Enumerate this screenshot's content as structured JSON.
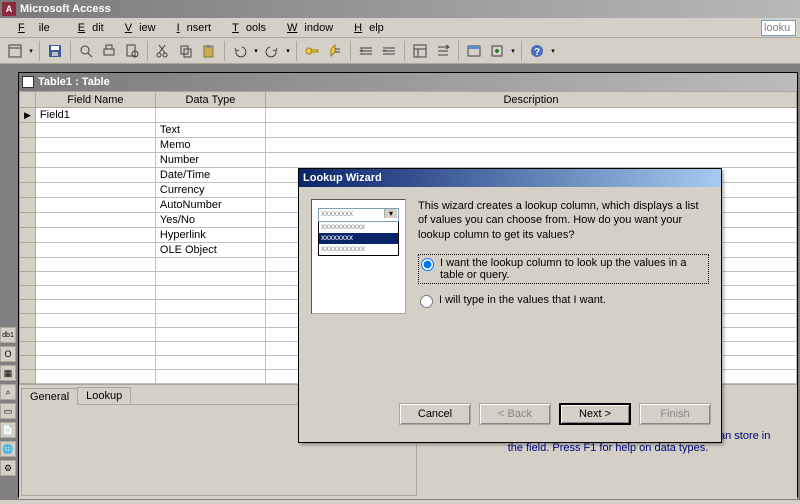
{
  "titlebar": {
    "app": "Microsoft Access"
  },
  "menu": {
    "file": "File",
    "edit": "Edit",
    "view": "View",
    "insert": "Insert",
    "tools": "Tools",
    "window": "Window",
    "help": "Help",
    "search_hint": "looku"
  },
  "tablewin": {
    "title": "Table1 : Table"
  },
  "grid": {
    "headers": {
      "field": "Field Name",
      "type": "Data Type",
      "desc": "Description"
    },
    "row1_field": "Field1",
    "types": [
      "Text",
      "Memo",
      "Number",
      "Date/Time",
      "Currency",
      "AutoNumber",
      "Yes/No",
      "Hyperlink",
      "OLE Object"
    ]
  },
  "tabs": {
    "general": "General",
    "lookup": "Lookup"
  },
  "hint": "The data type determines the kind of values that users can store in the field.  Press F1 for help on data types.",
  "wizard": {
    "title": "Lookup Wizard",
    "intro": "This wizard creates a lookup column, which displays a list of values you can choose from.  How do you want your lookup column to get its values?",
    "opt1": "I want the lookup column to look up the values in a table or query.",
    "opt2": "I will type in the values that I want.",
    "preview": {
      "combo": "xxxxxxxx",
      "r1": "xxxxxxxxxxx",
      "r2": "xxxxxxxx",
      "r3": "xxxxxxxxxxx"
    },
    "btn_cancel": "Cancel",
    "btn_back": "< Back",
    "btn_next": "Next >",
    "btn_finish": "Finish"
  },
  "leftnub": {
    "db": "db1",
    "o": "O"
  }
}
